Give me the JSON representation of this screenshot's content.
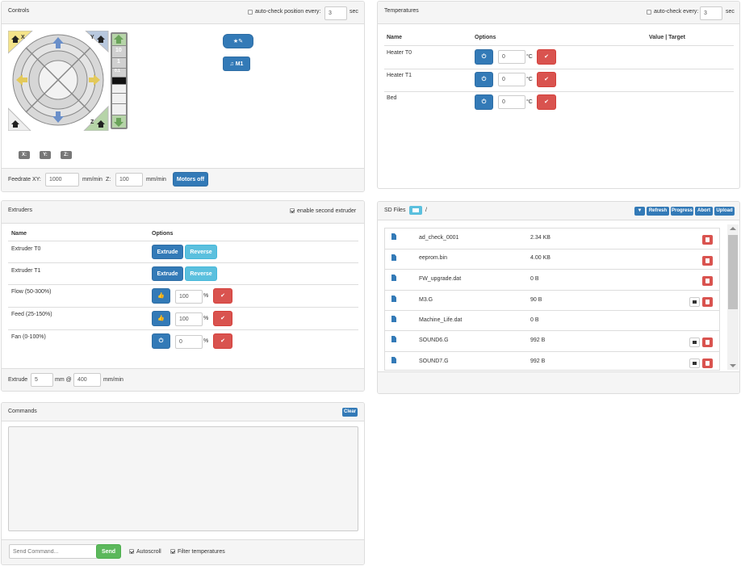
{
  "controls": {
    "title": "Controls",
    "autocheck_label": "auto-check position every:",
    "autocheck_value": "3",
    "sec": "sec",
    "macro_btn_label": "★✎",
    "m1_label": "♫ M1",
    "jog_steps": [
      "10",
      "1",
      "0.1"
    ],
    "jog_labels": {
      "x_home": "X",
      "y_home": "Y",
      "z_home": "Z"
    },
    "coords": [
      "X:",
      "Y:",
      "Z:"
    ],
    "feedrate_xy_label": "Feedrate XY:",
    "feedrate_xy_value": "1000",
    "mm_min_1": "mm/min",
    "z_label": "Z:",
    "feedrate_z_value": "100",
    "mm_min_2": "mm/min",
    "motors_off": "Motors off"
  },
  "temperatures": {
    "title": "Temperatures",
    "autocheck_label": "auto-check every:",
    "autocheck_value": "3",
    "sec": "sec",
    "headers": {
      "name": "Name",
      "options": "Options",
      "value": "Value | Target"
    },
    "rows": [
      {
        "name": "Heater T0",
        "value": "0",
        "unit": "°C"
      },
      {
        "name": "Heater T1",
        "value": "0",
        "unit": "°C"
      },
      {
        "name": "Bed",
        "value": "0",
        "unit": "°C"
      }
    ]
  },
  "extruders": {
    "title": "Extruders",
    "enable_second": "enable second extruder",
    "headers": {
      "name": "Name",
      "options": "Options"
    },
    "rows": [
      {
        "name": "Extruder T0",
        "btn1": "Extrude",
        "btn2": "Reverse"
      },
      {
        "name": "Extruder T1",
        "btn1": "Extrude",
        "btn2": "Reverse"
      }
    ],
    "rate_rows": [
      {
        "name": "Flow (50-300%)",
        "value": "100",
        "unit": "%"
      },
      {
        "name": "Feed (25-150%)",
        "value": "100",
        "unit": "%"
      },
      {
        "name": "Fan (0-100%)",
        "value": "0",
        "unit": "%"
      }
    ],
    "extrude_label": "Extrude",
    "extrude_value": "5",
    "mm_at": "mm @",
    "speed_value": "400",
    "mm_min": "mm/min"
  },
  "sdfiles": {
    "title": "SD Files",
    "path": "/",
    "buttons": {
      "refresh": "Refresh",
      "progress": "Progress",
      "abort": "Abort",
      "upload": "Upload"
    },
    "files": [
      {
        "name": "ad_check_0001",
        "size": "2.34 KB",
        "printable": false
      },
      {
        "name": "eeprom.bin",
        "size": "4.00 KB",
        "printable": false
      },
      {
        "name": "FW_upgrade.dat",
        "size": "0 B",
        "printable": false
      },
      {
        "name": "M3.G",
        "size": "90 B",
        "printable": true
      },
      {
        "name": "Machine_Life.dat",
        "size": "0 B",
        "printable": false
      },
      {
        "name": "SOUND6.G",
        "size": "992 B",
        "printable": true
      },
      {
        "name": "SOUND7.G",
        "size": "992 B",
        "printable": true
      }
    ]
  },
  "commands": {
    "title": "Commands",
    "clear": "Clear",
    "placeholder": "Send Command...",
    "send": "Send",
    "autoscroll": "Autoscroll",
    "filter_temps": "Filter temperatures"
  },
  "colors": {
    "primary": "#337ab7",
    "info": "#5bc0de",
    "danger": "#d9534f",
    "success": "#5cb85c",
    "panel_bg": "#f5f5f5",
    "border": "#dddddd"
  }
}
